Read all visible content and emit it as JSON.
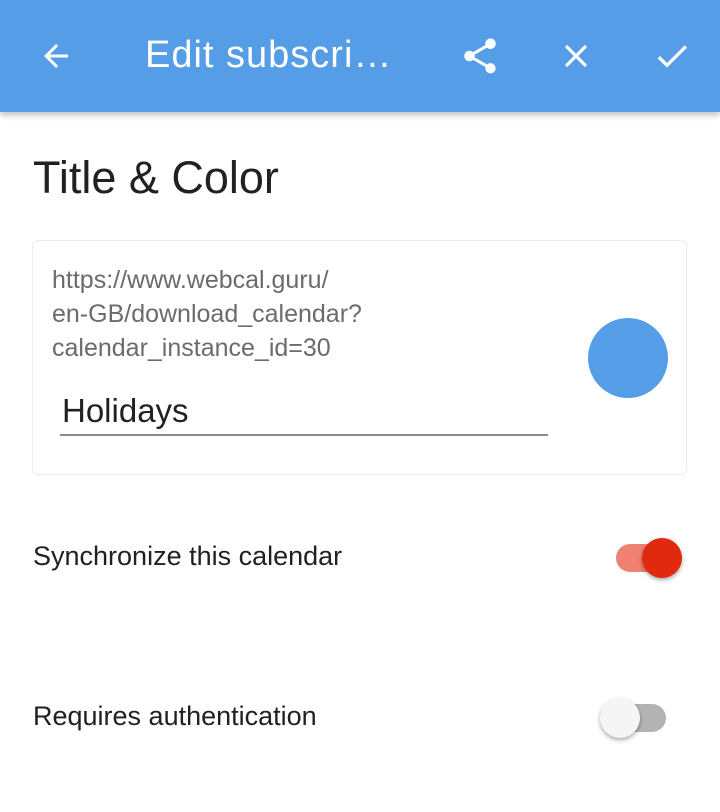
{
  "appbar": {
    "title": "Edit subscri…",
    "back_icon": "arrow-left-icon",
    "share_icon": "share-icon",
    "close_icon": "close-icon",
    "confirm_icon": "check-icon",
    "background": "#559de6"
  },
  "section": {
    "title": "Title & Color"
  },
  "subscription": {
    "url_lines": [
      "https://www.webcal.guru/",
      "en-GB/download_calendar?",
      "calendar_instance_id=30"
    ],
    "name_value": "Holidays",
    "color": "#559de6"
  },
  "settings": [
    {
      "label": "Synchronize this calendar",
      "enabled": true,
      "accent": "#e0290f"
    },
    {
      "label": "Requires authentication",
      "enabled": false
    }
  ]
}
